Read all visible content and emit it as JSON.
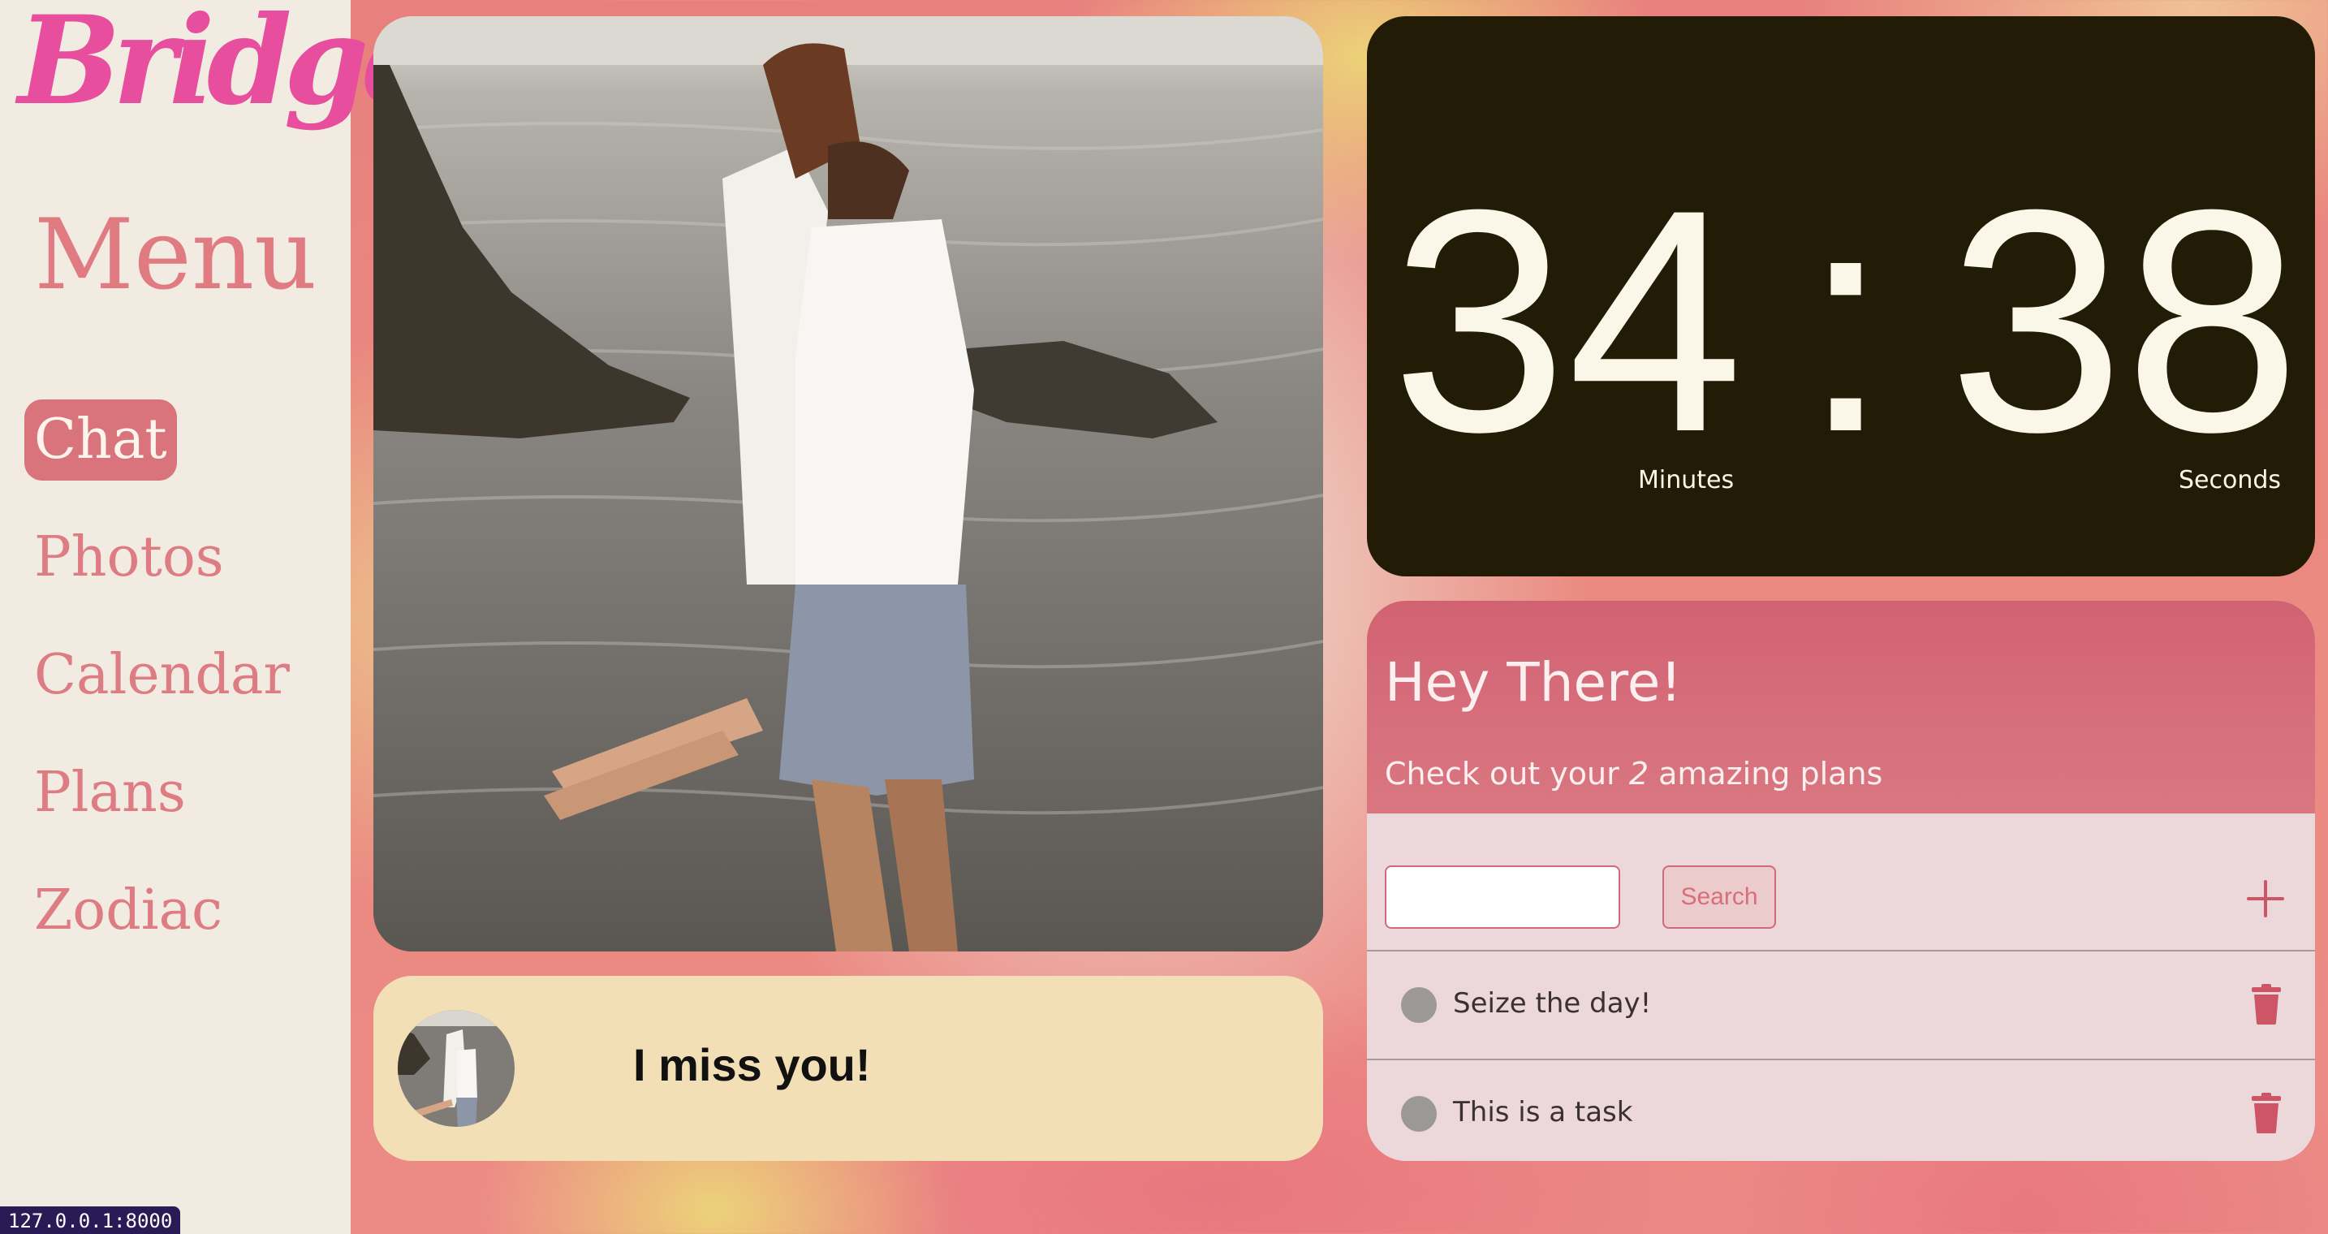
{
  "brand": {
    "logo_text": "Bridge",
    "color": "#e84e9e"
  },
  "sidebar": {
    "menu_title": "Menu",
    "items": [
      {
        "label": "Chat",
        "active": true
      },
      {
        "label": "Photos",
        "active": false
      },
      {
        "label": "Calendar",
        "active": false
      },
      {
        "label": "Plans",
        "active": false
      },
      {
        "label": "Zodiac",
        "active": false
      }
    ]
  },
  "message": {
    "text": "I miss you!"
  },
  "timer": {
    "minutes": "34",
    "separator": ":",
    "seconds": "38",
    "minutes_label": "Minutes",
    "seconds_label": "Seconds"
  },
  "plans": {
    "title": "Hey There!",
    "subtitle_prefix": "Check out your",
    "count": "2",
    "subtitle_suffix": "amazing plans",
    "search_value": "",
    "search_button": "Search",
    "tasks": [
      {
        "text": "Seize the day!"
      },
      {
        "text": "This is a task"
      }
    ]
  },
  "status": {
    "url": "127.0.0.1:8000"
  },
  "colors": {
    "accent": "#d9737c",
    "timer_bg": "#221c07",
    "message_bg": "#f3dfb6",
    "sidebar_bg": "#f2ebe2"
  }
}
